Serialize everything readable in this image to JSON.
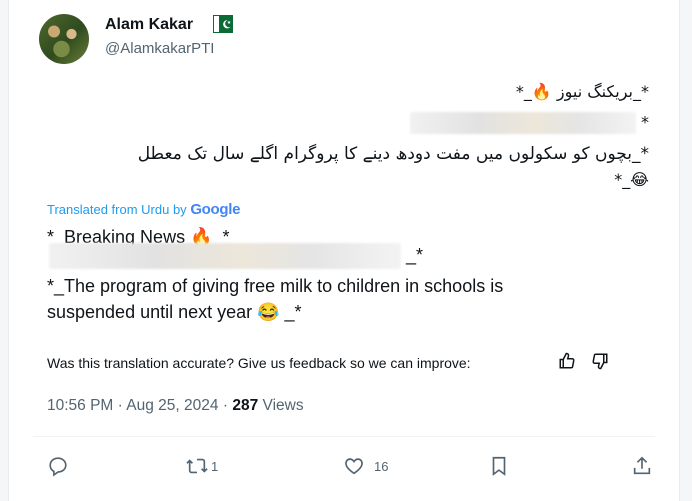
{
  "author": {
    "name": "Alam Kakar",
    "handle": "@AlamkakarPTI",
    "flag_icon": "pakistan-flag-icon"
  },
  "urdu": {
    "line1": "*_بریکنگ نیوز 🔥_*",
    "line2_suffix": "*",
    "line3": "*_بچوں کو سکولوں میں مفت دودھ دینے کا پروگرام اگلے سال تک معطل",
    "line4": "😂_*"
  },
  "translation": {
    "label": "Translated from Urdu by",
    "provider": "Google",
    "line1": "*_Breaking News 🔥_*",
    "line2_suffix": "_*",
    "line3": "*_The program of giving free milk to children in schools is",
    "line4": "suspended until next year 😂 _*"
  },
  "feedback": {
    "text": "Was this translation accurate? Give us feedback so we can improve:",
    "up_icon": "thumbs-up-icon",
    "down_icon": "thumbs-down-icon"
  },
  "meta": {
    "time": "10:56 PM",
    "separator": "·",
    "date": "Aug 25, 2024",
    "views_count": "287",
    "views_label": "Views"
  },
  "actions": {
    "reply_count": "",
    "retweet_count": "1",
    "like_count": "16"
  },
  "colors": {
    "link_blue": "#1d9bf0",
    "muted": "#536471",
    "text": "#0f1419"
  }
}
